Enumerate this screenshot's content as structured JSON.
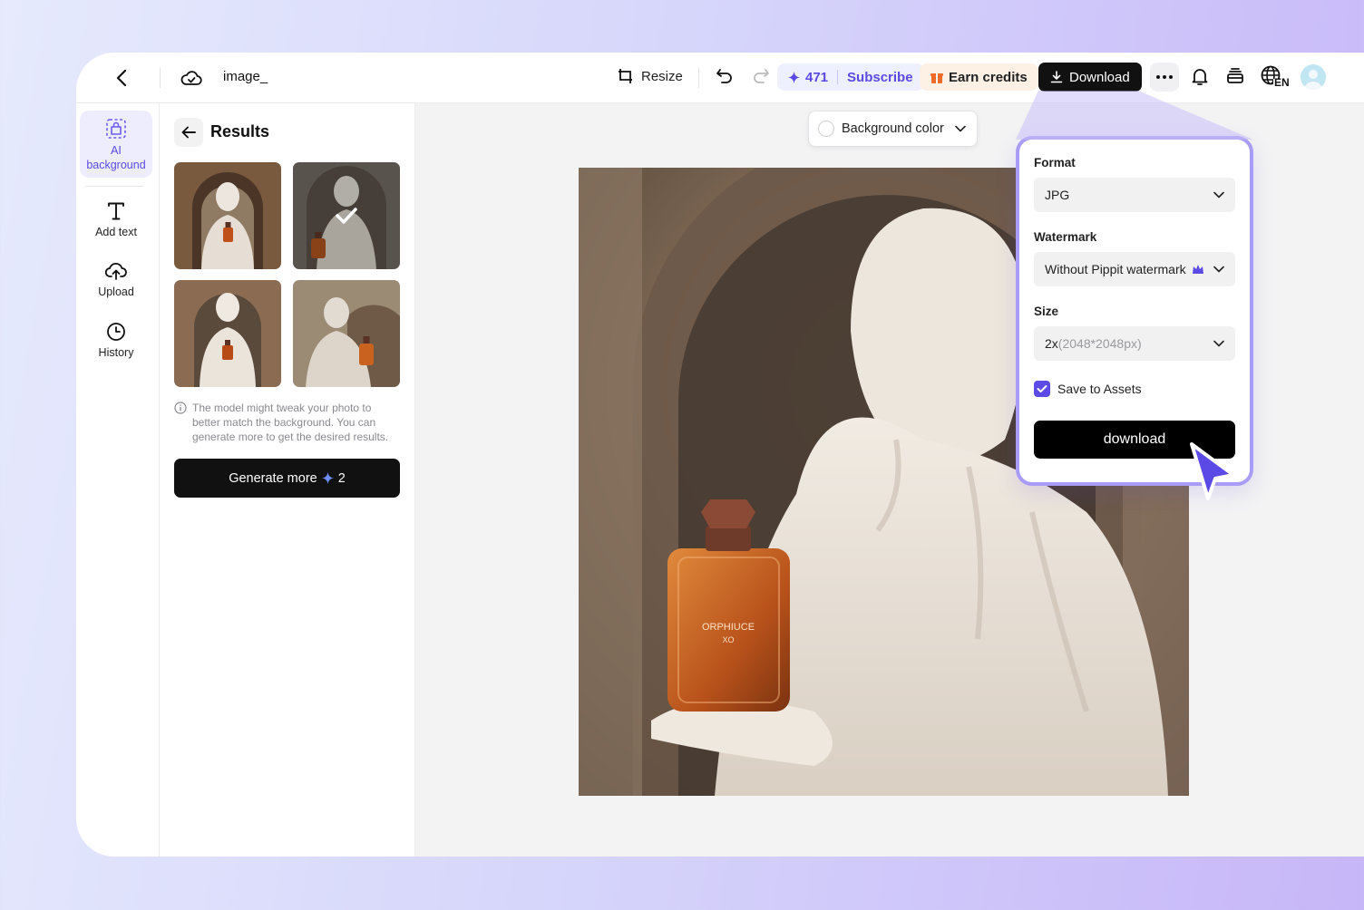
{
  "topbar": {
    "file_name": "image_",
    "resize_label": "Resize",
    "credits_count": "471",
    "subscribe_label": "Subscribe",
    "earn_credits_label": "Earn credits",
    "download_label": "Download",
    "language": "EN"
  },
  "rail": {
    "items": [
      {
        "label": "AI background"
      },
      {
        "label": "Add text"
      },
      {
        "label": "Upload"
      },
      {
        "label": "History"
      }
    ]
  },
  "results": {
    "title": "Results",
    "note": "The model might tweak your photo to better match the background. You can generate more to get the desired results.",
    "generate_label": "Generate more",
    "generate_cost": "2"
  },
  "canvas": {
    "background_color_label": "Background color"
  },
  "download_panel": {
    "format_label": "Format",
    "format_value": "JPG",
    "watermark_label": "Watermark",
    "watermark_value": "Without Pippit watermark",
    "size_label": "Size",
    "size_value": "2x",
    "size_detail": "(2048*2048px)",
    "save_label": "Save to Assets",
    "save_checked": true,
    "download_label": "download"
  },
  "colors": {
    "accent": "#5b4ae6",
    "popover_border": "#a99cf8",
    "primary_button": "#111111"
  }
}
